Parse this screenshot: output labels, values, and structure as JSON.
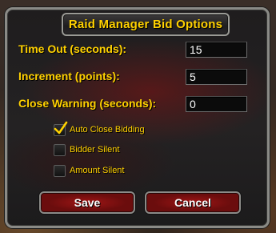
{
  "dialog": {
    "title": "Raid Manager Bid Options"
  },
  "fields": {
    "timeout": {
      "label": "Time Out (seconds):",
      "value": "15"
    },
    "increment": {
      "label": "Increment (points):",
      "value": "5"
    },
    "close_warning": {
      "label": "Close Warning (seconds):",
      "value": "0"
    }
  },
  "options": {
    "auto_close": {
      "label": "Auto Close Bidding",
      "checked": true
    },
    "bidder_silent": {
      "label": "Bidder Silent",
      "checked": false
    },
    "amount_silent": {
      "label": "Amount Silent",
      "checked": false
    }
  },
  "buttons": {
    "save": "Save",
    "cancel": "Cancel"
  },
  "colors": {
    "label_gold": "#ffd100",
    "button_red": "#a01616",
    "border_gray": "#8b8b88"
  }
}
